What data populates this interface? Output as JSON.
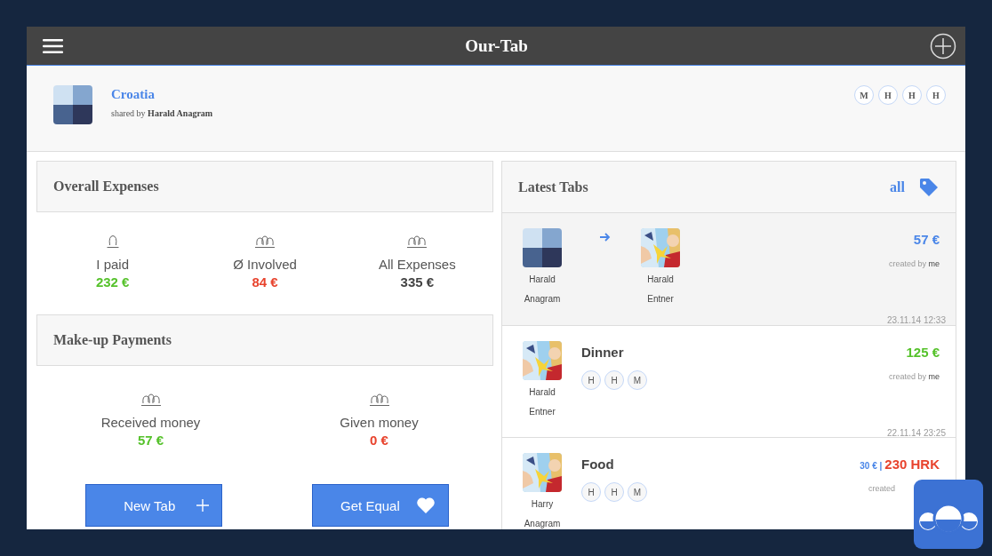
{
  "app_bar": {
    "title": "Our-Tab"
  },
  "group": {
    "name": "Croatia",
    "shared_prefix": "shared by",
    "owner": "Harald Anagram",
    "avatar": {
      "kind": "pattern"
    },
    "members": [
      "M",
      "H",
      "H",
      "H"
    ]
  },
  "overall": {
    "title": "Overall Expenses",
    "stats": [
      {
        "kind": "single",
        "label": "I paid",
        "value": "232 €",
        "color": "#56c22c"
      },
      {
        "kind": "group",
        "label": "Ø Involved",
        "value": "84 €",
        "color": "#e8432d"
      },
      {
        "kind": "group",
        "label": "All Expenses",
        "value": "335 €",
        "color": "#444444"
      }
    ]
  },
  "makeup": {
    "title": "Make-up Payments",
    "stats": [
      {
        "kind": "group",
        "label": "Received money",
        "value": "57 €",
        "color": "#56c22c"
      },
      {
        "kind": "group",
        "label": "Given money",
        "value": "0 €",
        "color": "#e8432d"
      }
    ]
  },
  "buttons": [
    {
      "label": "New Tab"
    },
    {
      "label": "Get Equal"
    }
  ],
  "latest": {
    "title": "Latest Tabs",
    "link": "all",
    "tabs": [
      {
        "kind": "transfer",
        "from": {
          "name": "Harald Anagram",
          "avatar": {
            "kind": "pattern"
          }
        },
        "to": {
          "name": "Harald Entner"
        },
        "amount": "57 €",
        "color": "#4a86e8",
        "created_label": "created by",
        "creator": "me",
        "date": "23.11.14 12:33"
      },
      {
        "kind": "expense",
        "payer": {
          "name": "Harald Entner"
        },
        "title": "Dinner",
        "members": [
          "H",
          "H",
          "M"
        ],
        "amount": "125 €",
        "color": "#56c22c",
        "created_label": "created by",
        "creator": "me",
        "date": "22.11.14 23:25"
      },
      {
        "kind": "expense",
        "payer": {
          "name": "Harry Anagram"
        },
        "title": "Food",
        "members": [
          "H",
          "H",
          "M"
        ],
        "converted": "30 € |",
        "amount": "230 HRK",
        "color": "#e8432d",
        "created_label": "created"
      }
    ]
  }
}
